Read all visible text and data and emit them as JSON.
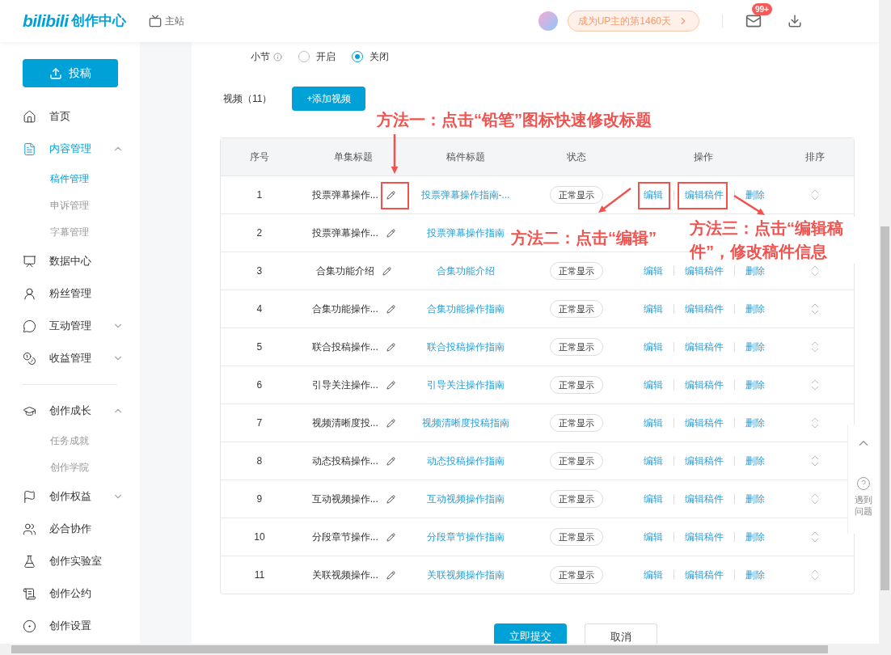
{
  "header": {
    "logo": "bilibili",
    "logo_suffix": "创作中心",
    "main_site": "主站",
    "up_days": "成为UP主的第1460天",
    "message_badge": "99+"
  },
  "sidebar": {
    "upload_button": "投稿",
    "items": [
      {
        "label": "首页",
        "selected": false
      },
      {
        "label": "内容管理",
        "selected": true,
        "expanded": true,
        "children": [
          {
            "label": "稿件管理",
            "selected": true
          },
          {
            "label": "申诉管理",
            "selected": false
          },
          {
            "label": "字幕管理",
            "selected": false
          }
        ]
      },
      {
        "label": "数据中心",
        "selected": false
      },
      {
        "label": "粉丝管理",
        "selected": false
      },
      {
        "label": "互动管理",
        "selected": false,
        "expanded": false
      },
      {
        "label": "收益管理",
        "selected": false,
        "expanded": false
      },
      {
        "kind": "divider"
      },
      {
        "label": "创作成长",
        "selected": false,
        "expanded": true,
        "children": [
          {
            "label": "任务成就",
            "selected": false
          },
          {
            "label": "创作学院",
            "selected": false
          }
        ]
      },
      {
        "label": "创作权益",
        "selected": false,
        "expanded": false
      },
      {
        "label": "必合协作",
        "selected": false
      },
      {
        "label": "创作实验室",
        "selected": false
      },
      {
        "label": "创作公约",
        "selected": false
      },
      {
        "label": "创作设置",
        "selected": false
      }
    ]
  },
  "form": {
    "section_label": "小节",
    "radios": [
      {
        "label": "开启",
        "selected": false
      },
      {
        "label": "关闭",
        "selected": true
      }
    ],
    "video_count": "视频（11）",
    "add_button": "+添加视频"
  },
  "table": {
    "columns": [
      "序号",
      "单集标题",
      "稿件标题",
      "状态",
      "操作",
      "排序"
    ],
    "rows": [
      {
        "index": "1",
        "episode_title": "投票弹幕操作...",
        "manuscript_title": "投票弹幕操作指南-...",
        "status": "正常显示",
        "actions": [
          "编辑",
          "编辑稿件",
          "删除"
        ],
        "sort_handle": true
      },
      {
        "index": "2",
        "episode_title": "投票弹幕操作...",
        "manuscript_title": "投票弹幕操作指南",
        "sort_handle": false
      },
      {
        "index": "3",
        "episode_title": "合集功能介绍",
        "manuscript_title": "合集功能介绍",
        "status": "正常显示",
        "actions": [
          "编辑",
          "编辑稿件",
          "删除"
        ],
        "sort_handle": true
      },
      {
        "index": "4",
        "episode_title": "合集功能操作...",
        "manuscript_title": "合集功能操作指南",
        "status": "正常显示",
        "actions": [
          "编辑",
          "编辑稿件",
          "删除"
        ],
        "sort_handle": true
      },
      {
        "index": "5",
        "episode_title": "联合投稿操作...",
        "manuscript_title": "联合投稿操作指南",
        "status": "正常显示",
        "actions": [
          "编辑",
          "编辑稿件",
          "删除"
        ],
        "sort_handle": true
      },
      {
        "index": "6",
        "episode_title": "引导关注操作...",
        "manuscript_title": "引导关注操作指南",
        "status": "正常显示",
        "actions": [
          "编辑",
          "编辑稿件",
          "删除"
        ],
        "sort_handle": true
      },
      {
        "index": "7",
        "episode_title": "视频清晰度投...",
        "manuscript_title": "视频清晰度投稿指南",
        "status": "正常显示",
        "actions": [
          "编辑",
          "编辑稿件",
          "删除"
        ],
        "sort_handle": true
      },
      {
        "index": "8",
        "episode_title": "动态投稿操作...",
        "manuscript_title": "动态投稿操作指南",
        "status": "正常显示",
        "actions": [
          "编辑",
          "编辑稿件",
          "删除"
        ],
        "sort_handle": true
      },
      {
        "index": "9",
        "episode_title": "互动视频操作...",
        "manuscript_title": "互动视频操作指南",
        "status": "正常显示",
        "actions": [
          "编辑",
          "编辑稿件",
          "删除"
        ],
        "sort_handle": true
      },
      {
        "index": "10",
        "episode_title": "分段章节操作...",
        "manuscript_title": "分段章节操作指南",
        "status": "正常显示",
        "actions": [
          "编辑",
          "编辑稿件",
          "删除"
        ],
        "sort_handle": true
      },
      {
        "index": "11",
        "episode_title": "关联视频操作...",
        "manuscript_title": "关联视频操作指南",
        "status": "正常显示",
        "actions": [
          "编辑",
          "编辑稿件",
          "删除"
        ],
        "sort_handle": true
      }
    ]
  },
  "footer": {
    "submit_button": "立即提交",
    "cancel_button": "取消"
  },
  "help": {
    "label": "遇到问题"
  },
  "annotations": [
    "方法一：点击“铅笔”图标快速修改标题",
    "方法二：点击“编辑”",
    "方法三：点击“编辑稿件”，修改稿件信息"
  ]
}
